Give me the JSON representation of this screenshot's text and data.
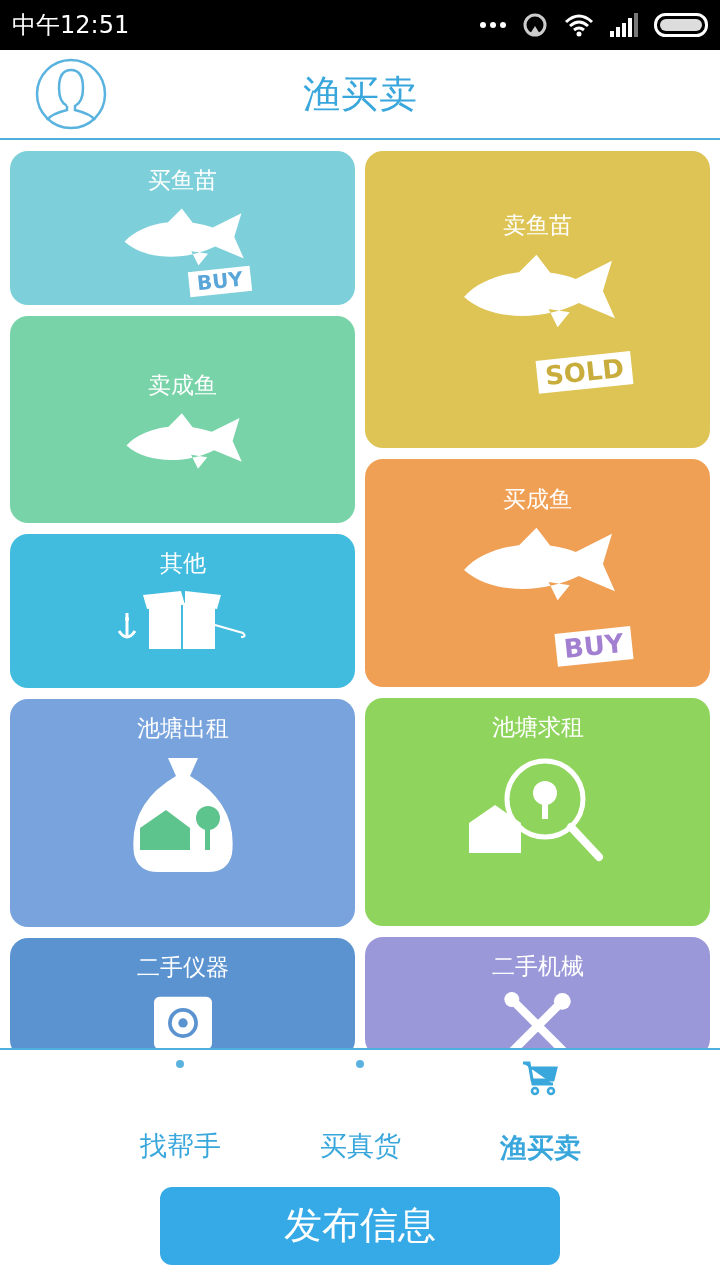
{
  "status_bar": {
    "time": "中午12:51"
  },
  "header": {
    "title": "渔买卖"
  },
  "columns": [
    {
      "tiles": [
        {
          "title": "买鱼苗",
          "kind": "fish-sign",
          "sign": "BUY",
          "color": "#7dcfd9"
        },
        {
          "title": "卖成鱼",
          "kind": "fish",
          "color": "#78d3a8"
        },
        {
          "title": "其他",
          "kind": "box",
          "color": "#41bbde"
        },
        {
          "title": "池塘出租",
          "kind": "bag",
          "color": "#78a3dc"
        },
        {
          "title": "二手仪器",
          "kind": "safe",
          "color": "#5b93d0"
        }
      ]
    },
    {
      "tiles": [
        {
          "title": "卖鱼苗",
          "kind": "big-fish-sign",
          "sign": "SOLD",
          "color": "#dec454"
        },
        {
          "title": "买成鱼",
          "kind": "big-fish-sign",
          "sign": "BUY",
          "color": "#f0a055"
        },
        {
          "title": "池塘求租",
          "kind": "search",
          "color": "#8fd45c"
        },
        {
          "title": "二手机械",
          "kind": "tools",
          "color": "#9a98d9"
        }
      ]
    }
  ],
  "tabs": [
    {
      "label": "找帮手",
      "selected": false
    },
    {
      "label": "买真货",
      "selected": false
    },
    {
      "label": "渔买卖",
      "selected": true
    }
  ],
  "publish_button": "发布信息"
}
